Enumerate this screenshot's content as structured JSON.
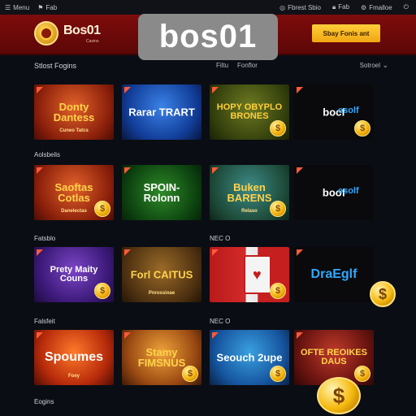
{
  "sysbar": {
    "left_items": [
      "Menu",
      "Fab"
    ],
    "right_items": [
      "Fbrest Sbio",
      "Fab",
      "Fmalloe",
      ""
    ]
  },
  "header": {
    "logo_text": "Bos01",
    "logo_sub": "Casino",
    "overlay_brand": "bos01",
    "cta_label": "Sbay Fonis ant"
  },
  "toolbar": {
    "section_title": "Stlost Fogins",
    "filter_a": "Filtu",
    "filter_b": "Fonflor",
    "sort_label": "Sotroel"
  },
  "rows": [
    {
      "label": "",
      "tiles": [
        {
          "title": "Donty Dantess",
          "sub": "Cuneo Tatcs",
          "theme": "th-red",
          "color": "#ffd34a",
          "coin": false
        },
        {
          "title": "Rarar TRART",
          "sub": "",
          "theme": "th-blue",
          "color": "#ffffff",
          "coin": false
        },
        {
          "title": "HOPY OBYPLO BRONES",
          "sub": "",
          "theme": "th-olive",
          "color": "#ffcf3a",
          "coin": true
        },
        {
          "title": "bocf",
          "sub": "",
          "theme": "th-dark",
          "color": "#ffffff",
          "coin": true,
          "brandlogo": "esolf"
        }
      ]
    },
    {
      "label": "Aolsbelis",
      "tiles": [
        {
          "title": "Saoftas Cotlas",
          "sub": "Danelectas",
          "theme": "th-red",
          "color": "#ffd34a",
          "coin": true
        },
        {
          "title": "SPOIN- Rolonn",
          "sub": "",
          "theme": "th-green",
          "color": "#ffffff",
          "coin": false
        },
        {
          "title": "Buken BARENS",
          "sub": "Relaso",
          "theme": "th-teal",
          "color": "#ffd34a",
          "coin": true
        },
        {
          "title": "boof",
          "sub": "",
          "theme": "th-dark",
          "color": "#ffffff",
          "coin": false,
          "brandlogo": "esolf"
        }
      ]
    },
    {
      "label": "Fatsblo",
      "tiles": [
        {
          "title": "Prety Maity Couns",
          "sub": "",
          "theme": "th-purple",
          "color": "#ffffff",
          "coin": true
        },
        {
          "title": "Forl CAITUS",
          "sub": "Pnrossioae",
          "theme": "th-brown",
          "color": "#ffd34a",
          "coin": false
        },
        {
          "title": "",
          "sub": "",
          "theme": "th-card",
          "color": "#ffffff",
          "coin": true
        },
        {
          "title": "DraEglf",
          "sub": "",
          "theme": "th-dark",
          "color": "#2ea8ff",
          "coin": false
        }
      ]
    },
    {
      "label": "Falsfeit",
      "tiles": [
        {
          "title": "Spoumes",
          "sub": "Foey",
          "theme": "th-red2",
          "color": "#ffffff",
          "coin": false
        },
        {
          "title": "Stamy FIMSNUS",
          "sub": "",
          "theme": "th-orange",
          "color": "#ffd34a",
          "coin": true
        },
        {
          "title": "Seouch 2upe",
          "sub": "",
          "theme": "th-ocean",
          "color": "#ffffff",
          "coin": true
        },
        {
          "title": "OFTE REOIKES DAUS",
          "sub": "",
          "theme": "th-crimson",
          "color": "#ffd34a",
          "coin": true
        }
      ]
    }
  ],
  "row_right_labels": [
    "",
    "",
    "NEC O",
    "NEC O"
  ],
  "footer_label": "Eogins",
  "colors": {
    "header_red": "#7e0c0c",
    "cta_gold": "#ffcf3a",
    "background": "#0b0d14"
  }
}
